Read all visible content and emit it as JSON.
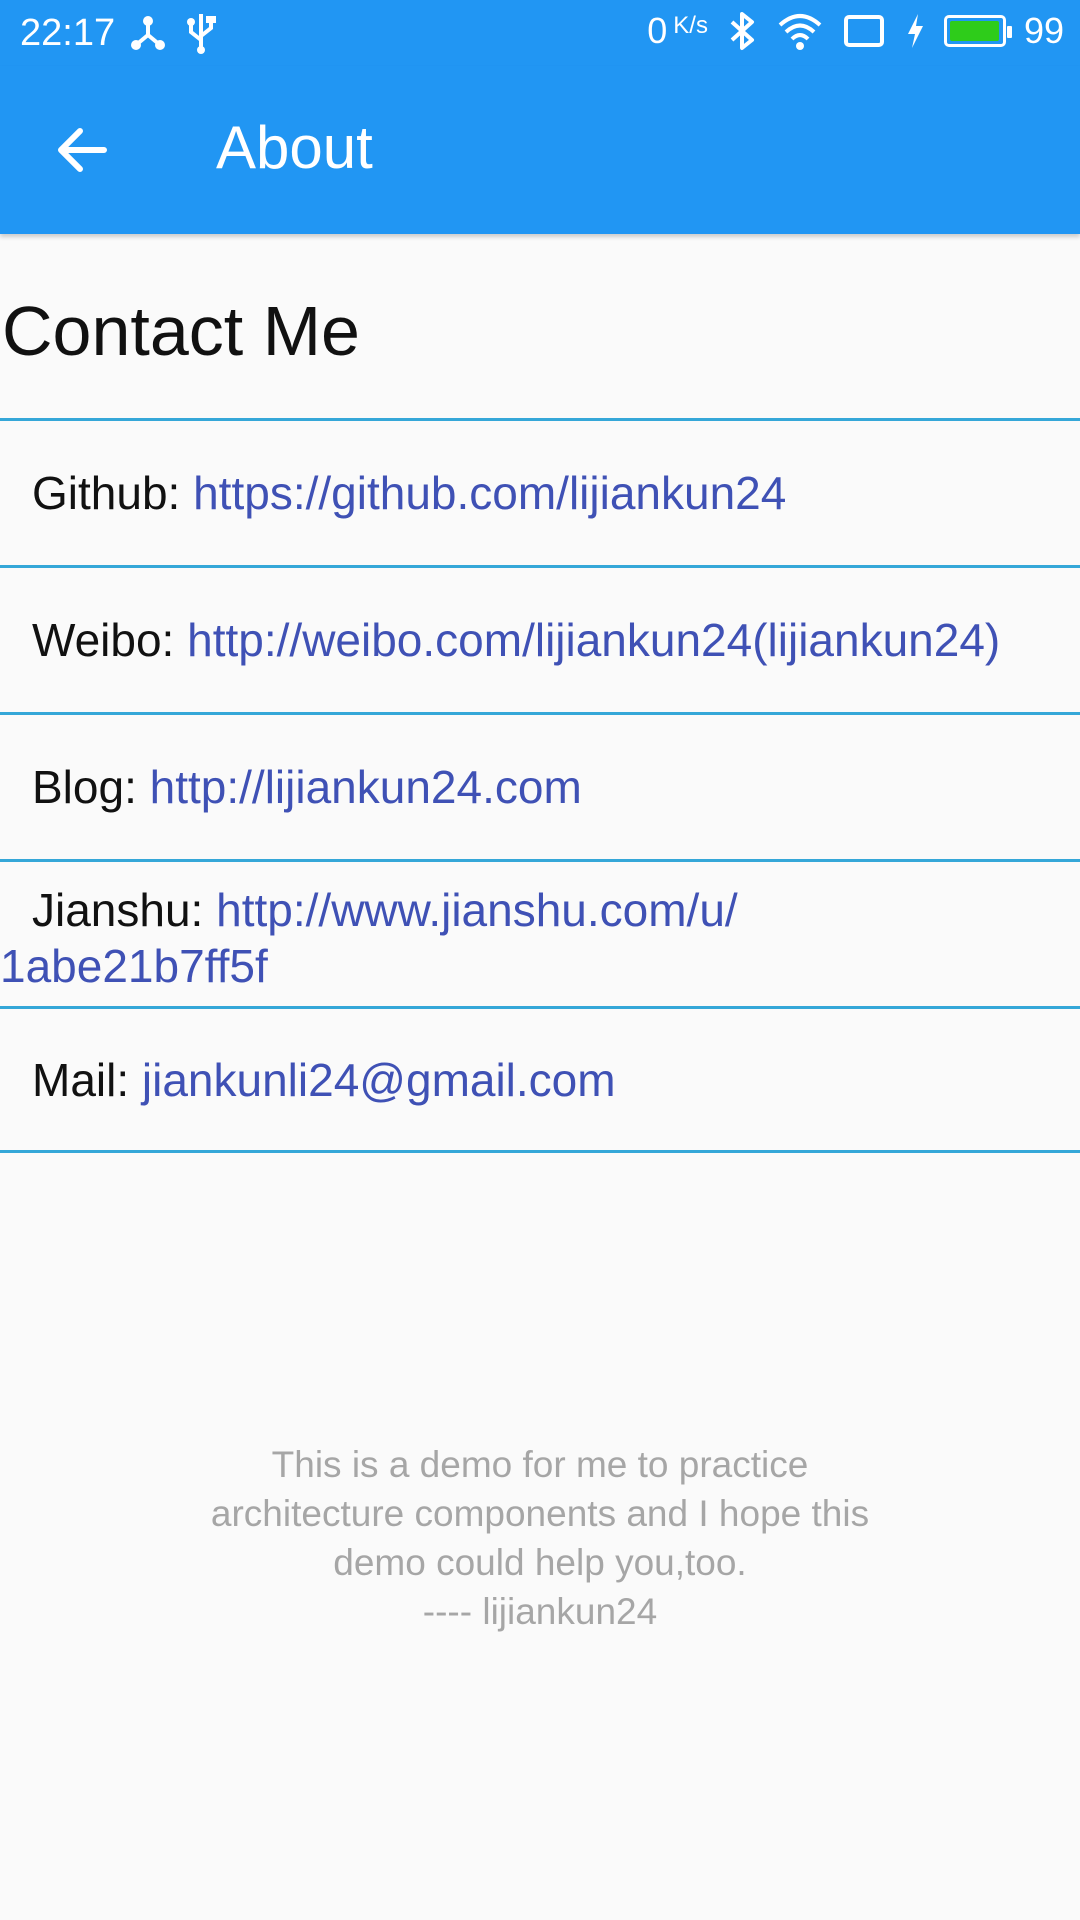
{
  "status_bar": {
    "time": "22:17",
    "net_speed_value": "0",
    "net_speed_unit": "K/s",
    "battery_percent": "99",
    "battery_level": 0.99,
    "battery_color": "#2ecc1a",
    "icons": [
      "usb-share-icon",
      "usb-icon",
      "bluetooth-icon",
      "wifi-icon",
      "screen-cast-icon",
      "charging-icon",
      "battery-icon"
    ]
  },
  "app_bar": {
    "title": "About",
    "background": "#2196f3"
  },
  "section_title": "Contact Me",
  "contacts": [
    {
      "label": "Github: ",
      "value": "https://github.com/lijiankun24"
    },
    {
      "label": "Weibo: ",
      "value": "http://weibo.com/lijiankun24(lijiankun24)"
    },
    {
      "label": "Blog: ",
      "value": "http://lijiankun24.com"
    },
    {
      "label": "Jianshu: ",
      "value": "http://www.jianshu.com/u/1abe21b7ff5f"
    },
    {
      "label": "Mail: ",
      "value": "jiankunli24@gmail.com"
    }
  ],
  "footer": {
    "lines": [
      "This is a demo for me to practice",
      "architecture components and I hope this",
      "demo could help you,too.",
      "---- lijiankun24"
    ]
  },
  "colors": {
    "link": "#3f51b5",
    "divider": "#35a7d8",
    "footer_text": "#a6a6a6"
  }
}
